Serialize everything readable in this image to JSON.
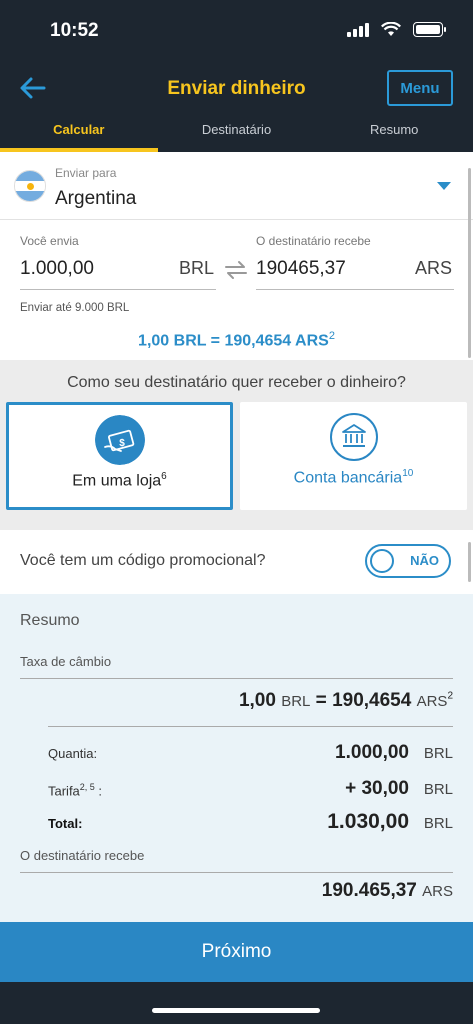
{
  "status_bar": {
    "time": "10:52"
  },
  "header": {
    "title": "Enviar dinheiro",
    "menu_label": "Menu"
  },
  "tabs": [
    {
      "label": "Calcular",
      "active": true
    },
    {
      "label": "Destinatário",
      "active": false
    },
    {
      "label": "Resumo",
      "active": false
    }
  ],
  "destination": {
    "label": "Enviar para",
    "value": "Argentina",
    "flag_icon": "argentina-flag-icon"
  },
  "send": {
    "label": "Você envia",
    "amount": "1.000,00",
    "currency": "BRL",
    "limit_text": "Enviar até  9.000  BRL"
  },
  "receive": {
    "label": "O destinatário recebe",
    "amount": "190465,37",
    "currency": "ARS"
  },
  "rate": {
    "text": "1,00 BRL = 190,4654 ARS",
    "sup": "2"
  },
  "delivery": {
    "question": "Como seu destinatário quer receber o dinheiro?",
    "options": [
      {
        "label": "Em uma loja",
        "sup": "6",
        "icon": "store-cash-icon",
        "selected": true
      },
      {
        "label": "Conta bancária",
        "sup": "10",
        "icon": "bank-icon",
        "selected": false
      }
    ]
  },
  "promo": {
    "question": "Você tem um código promocional?",
    "toggle_label": "NÃO"
  },
  "summary": {
    "title": "Resumo",
    "rate_label": "Taxa de câmbio",
    "rate_left": "1,00",
    "rate_left_unit": "BRL",
    "rate_eq": "=",
    "rate_right": "190,4654",
    "rate_right_unit": "ARS",
    "rate_sup": "2",
    "quantity_label": "Quantia:",
    "quantity_value": "1.000,00",
    "quantity_unit": "BRL",
    "fee_label": "Tarifa",
    "fee_sup": "2, 5",
    "fee_colon": " :",
    "fee_value": "+ 30,00",
    "fee_unit": "BRL",
    "total_label": "Total:",
    "total_value": "1.030,00",
    "total_unit": "BRL",
    "receive_label": "O destinatário recebe",
    "receive_value": "190.465,37",
    "receive_unit": "ARS"
  },
  "next_button": "Próximo",
  "colors": {
    "header_bg": "#1d2630",
    "accent_yellow": "#f7c51e",
    "accent_blue": "#2b8dc8"
  }
}
